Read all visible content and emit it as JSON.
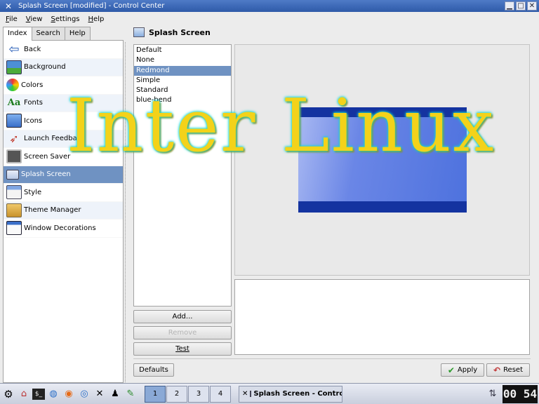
{
  "window": {
    "title": "Splash Screen [modified] - Control Center",
    "app_icon": "tools-icon"
  },
  "menu": [
    "File",
    "View",
    "Settings",
    "Help"
  ],
  "tabs": [
    "Index",
    "Search",
    "Help"
  ],
  "nav": [
    {
      "label": "Back",
      "icon": "back-arrow-icon"
    },
    {
      "label": "Background",
      "icon": "background-icon"
    },
    {
      "label": "Colors",
      "icon": "colors-icon"
    },
    {
      "label": "Fonts",
      "icon": "fonts-icon"
    },
    {
      "label": "Icons",
      "icon": "icons-icon"
    },
    {
      "label": "Launch Feedback",
      "icon": "launch-feedback-icon"
    },
    {
      "label": "Screen Saver",
      "icon": "screen-saver-icon"
    },
    {
      "label": "Splash Screen",
      "icon": "splash-screen-icon"
    },
    {
      "label": "Style",
      "icon": "style-icon"
    },
    {
      "label": "Theme Manager",
      "icon": "theme-manager-icon"
    },
    {
      "label": "Window Decorations",
      "icon": "window-decorations-icon"
    }
  ],
  "section_title": "Splash Screen",
  "themes": [
    "Default",
    "None",
    "Redmond",
    "Simple",
    "Standard",
    "blue-bend"
  ],
  "selected_theme": "Redmond",
  "buttons": {
    "add": "Add...",
    "remove": "Remove",
    "test": "Test",
    "defaults": "Defaults",
    "apply": "Apply",
    "reset": "Reset"
  },
  "watermark": "Inter Linux",
  "taskbar": {
    "desktops": [
      "1",
      "2",
      "3",
      "4"
    ],
    "active_task": "Splash Screen - Control Center",
    "clock": "00 54"
  },
  "colors": {
    "selection": "#6f92c2",
    "titlebar": "#2e5aa8",
    "watermark": "#f3d21a"
  }
}
